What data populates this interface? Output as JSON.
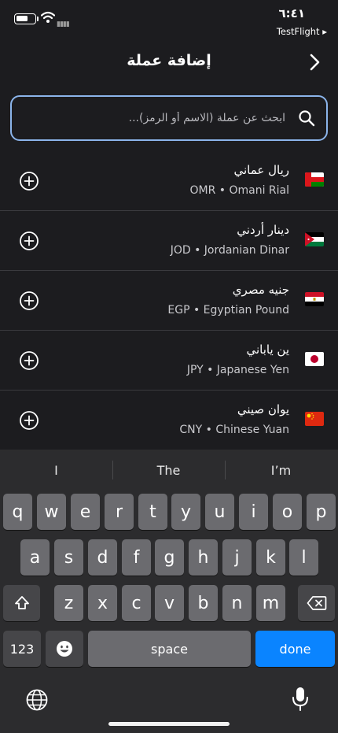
{
  "status": {
    "time": "٦:٤١",
    "back_app": "TestFlight ▸"
  },
  "header": {
    "title": "إضافة عملة"
  },
  "search": {
    "placeholder": "ابحث عن عملة (الاسم أو الرمز)..."
  },
  "currencies": [
    {
      "name": "ريال عماني",
      "subtitle": "OMR • Omani Rial",
      "flag": "OM"
    },
    {
      "name": "دينار أردني",
      "subtitle": "JOD • Jordanian Dinar",
      "flag": "JO"
    },
    {
      "name": "جنيه مصري",
      "subtitle": "EGP • Egyptian Pound",
      "flag": "EG"
    },
    {
      "name": "ين ياباني",
      "subtitle": "JPY • Japanese Yen",
      "flag": "JP"
    },
    {
      "name": "يوان صيني",
      "subtitle": "CNY • Chinese Yuan",
      "flag": "CN"
    }
  ],
  "keyboard": {
    "suggestions": [
      "I",
      "The",
      "I’m"
    ],
    "row1": [
      "q",
      "w",
      "e",
      "r",
      "t",
      "y",
      "u",
      "i",
      "o",
      "p"
    ],
    "row2": [
      "a",
      "s",
      "d",
      "f",
      "g",
      "h",
      "j",
      "k",
      "l"
    ],
    "row3": [
      "z",
      "x",
      "c",
      "v",
      "b",
      "n",
      "m"
    ],
    "numbers_label": "123",
    "space_label": "space",
    "done_label": "done"
  },
  "colors": {
    "background": "#1c1c1f",
    "search_border": "#8bb4ea",
    "done_key": "#0a84ff"
  },
  "icons": [
    "battery-icon",
    "wifi-icon",
    "chevron-icon",
    "search-icon",
    "plus-circle-icon",
    "flag-icon",
    "shift-icon",
    "backspace-icon",
    "emoji-icon",
    "globe-icon",
    "mic-icon"
  ]
}
